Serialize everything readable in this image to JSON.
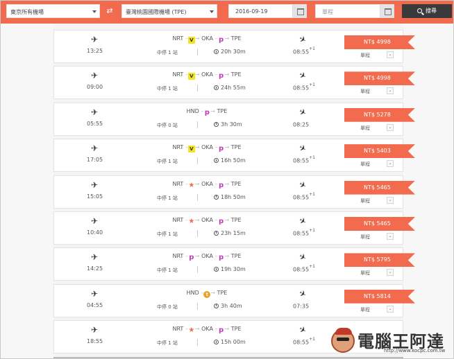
{
  "search": {
    "origin": "東京所有機場",
    "destination": "臺灣桃園國際機場 (TPE)",
    "date": "2016-09-19",
    "return_placeholder": "單程",
    "button_label": "搜尋"
  },
  "colors": {
    "accent": "#f26b4f",
    "search_button": "#3a3a3a"
  },
  "results": [
    {
      "dep": "13:25",
      "route": [
        "NRT",
        "OKA",
        "TPE"
      ],
      "logos": [
        "v",
        "p"
      ],
      "stops": "中停 1 站",
      "duration": "20h 30m",
      "arr": "08:55",
      "next_day": "+1",
      "price": "NT$ 4998",
      "trip": "單程"
    },
    {
      "dep": "09:00",
      "route": [
        "NRT",
        "OKA",
        "TPE"
      ],
      "logos": [
        "v",
        "p"
      ],
      "stops": "中停 1 站",
      "duration": "24h 55m",
      "arr": "08:55",
      "next_day": "+1",
      "price": "NT$ 4998",
      "trip": "單程"
    },
    {
      "dep": "05:55",
      "route": [
        "HND",
        "TPE"
      ],
      "logos": [
        "p"
      ],
      "stops": "中停 0 站",
      "duration": "3h 30m",
      "arr": "08:25",
      "next_day": "",
      "price": "NT$ 5278",
      "trip": "單程"
    },
    {
      "dep": "17:05",
      "route": [
        "NRT",
        "OKA",
        "TPE"
      ],
      "logos": [
        "v",
        "p"
      ],
      "stops": "中停 1 站",
      "duration": "16h 50m",
      "arr": "08:55",
      "next_day": "+1",
      "price": "NT$ 5403",
      "trip": "單程"
    },
    {
      "dep": "15:05",
      "route": [
        "NRT",
        "OKA",
        "TPE"
      ],
      "logos": [
        "star",
        "p"
      ],
      "stops": "中停 1 站",
      "duration": "18h 50m",
      "arr": "08:55",
      "next_day": "+1",
      "price": "NT$ 5465",
      "trip": "單程"
    },
    {
      "dep": "10:40",
      "route": [
        "NRT",
        "OKA",
        "TPE"
      ],
      "logos": [
        "star",
        "p"
      ],
      "stops": "中停 1 站",
      "duration": "23h 15m",
      "arr": "08:55",
      "next_day": "+1",
      "price": "NT$ 5465",
      "trip": "單程"
    },
    {
      "dep": "14:25",
      "route": [
        "NRT",
        "OKA",
        "TPE"
      ],
      "logos": [
        "p",
        "p"
      ],
      "stops": "中停 1 站",
      "duration": "19h 30m",
      "arr": "08:55",
      "next_day": "+1",
      "price": "NT$ 5795",
      "trip": "單程"
    },
    {
      "dep": "04:55",
      "route": [
        "HND",
        "TPE"
      ],
      "logos": [
        "t"
      ],
      "stops": "中停 0 站",
      "duration": "3h 40m",
      "arr": "07:35",
      "next_day": "",
      "price": "NT$ 5814",
      "trip": "單程"
    },
    {
      "dep": "18:55",
      "route": [
        "NRT",
        "OKA",
        "TPE"
      ],
      "logos": [
        "star",
        "p"
      ],
      "stops": "中停 1 站",
      "duration": "15h 00m",
      "arr": "08:55",
      "next_day": "+1",
      "price": "",
      "trip": ""
    }
  ],
  "watermark": {
    "title": "電腦王阿達",
    "url": "http://www.kocpc.com.tw"
  }
}
